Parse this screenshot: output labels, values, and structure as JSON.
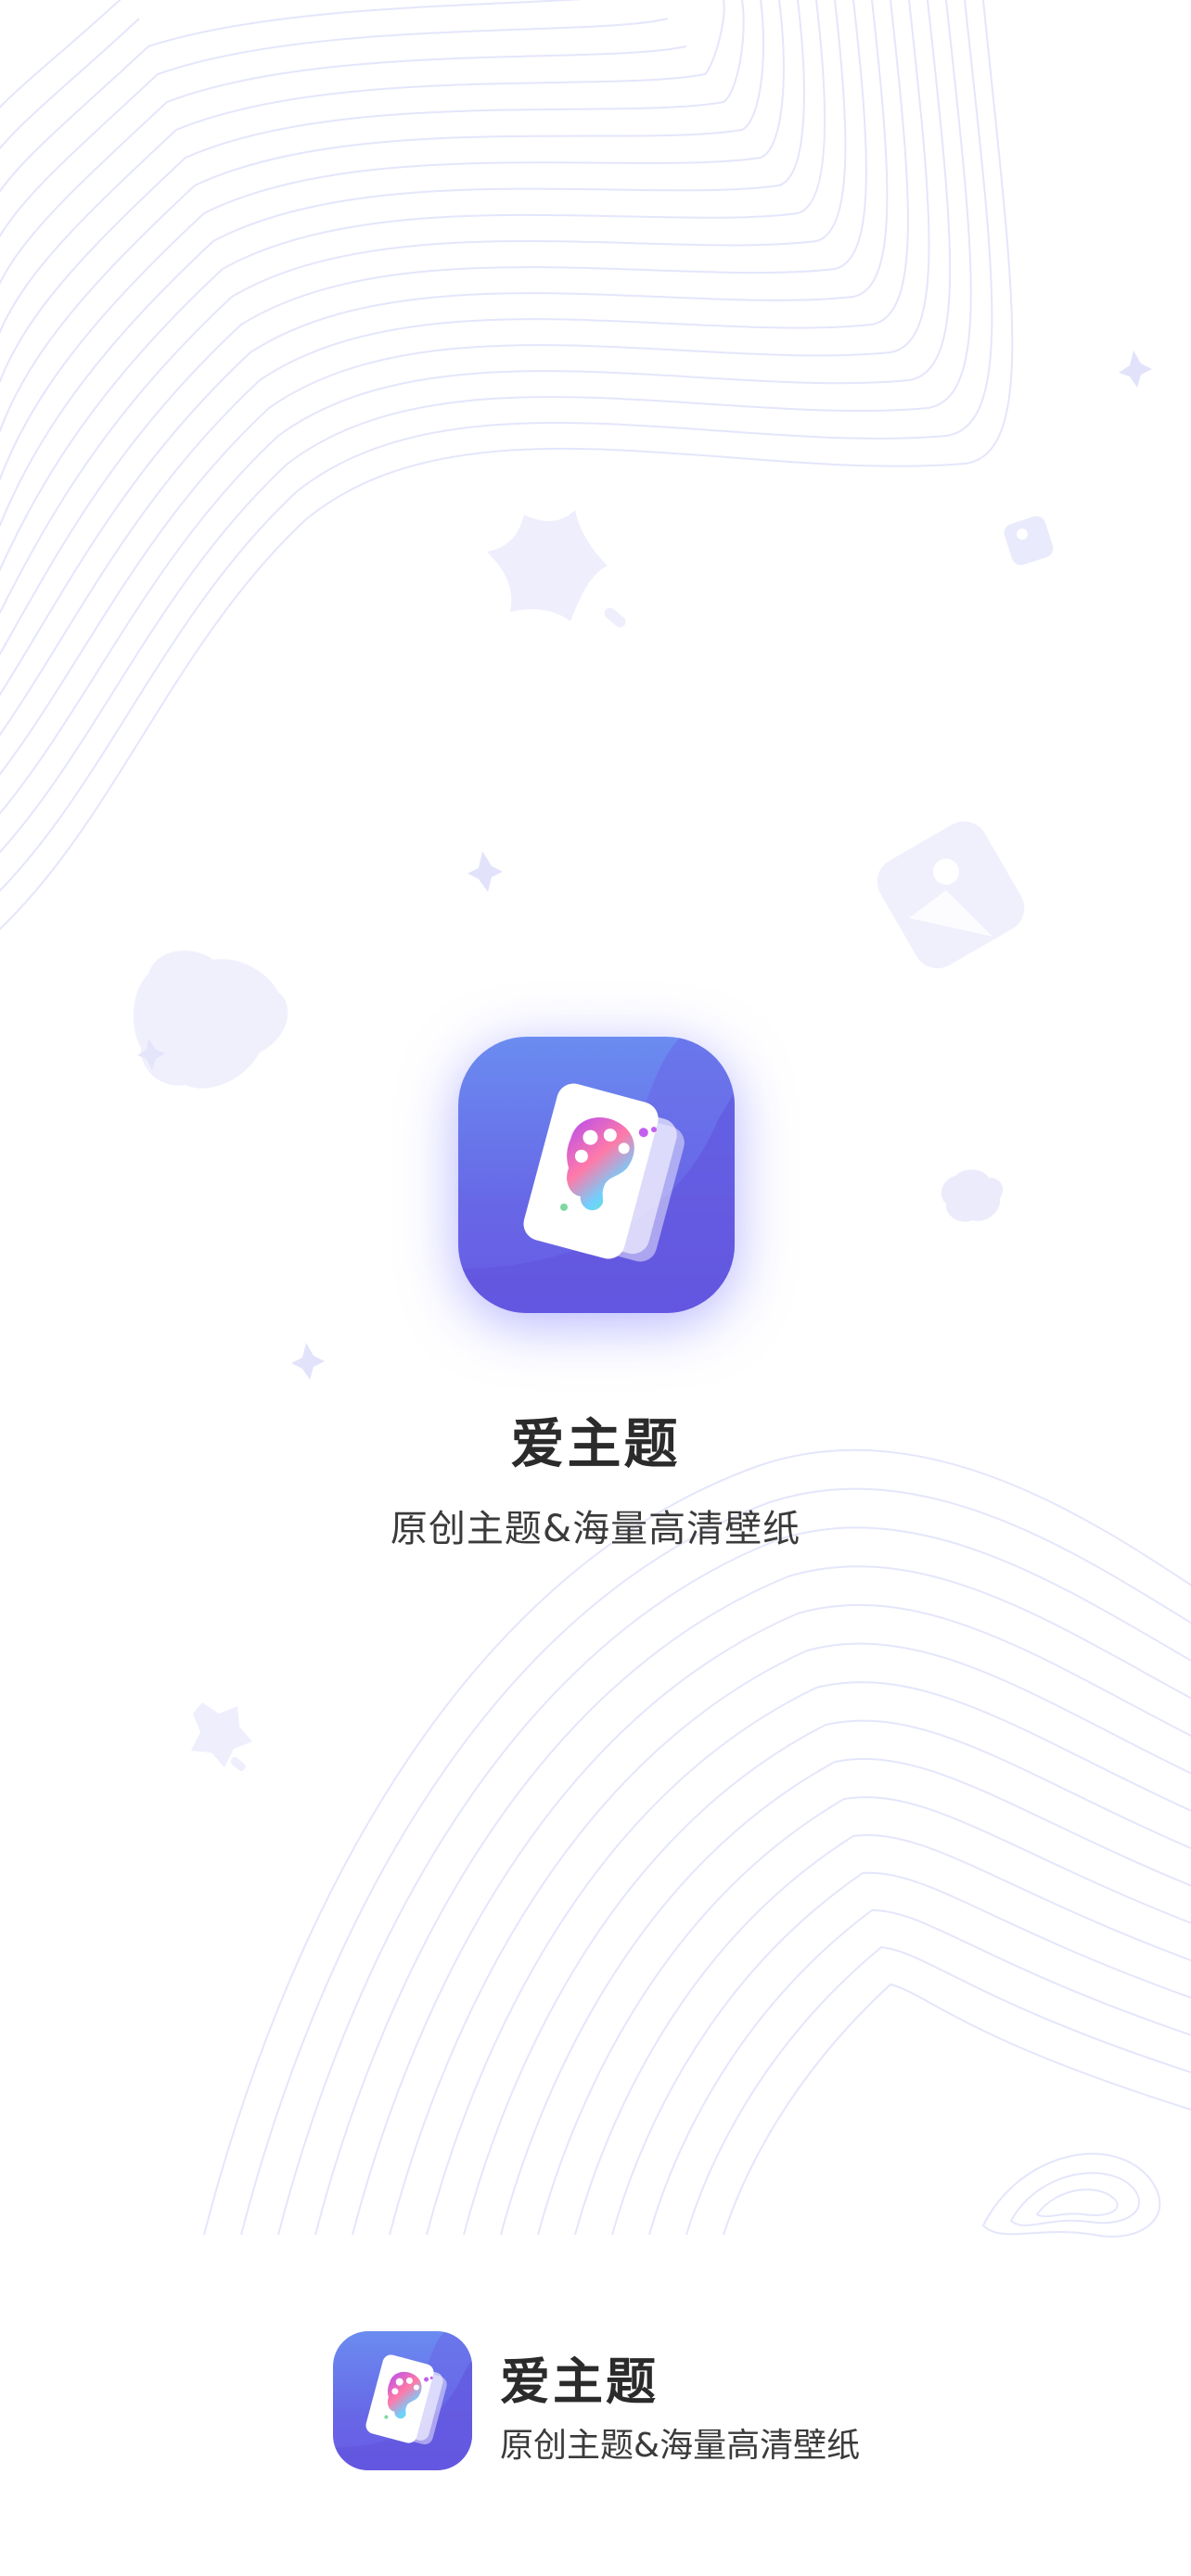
{
  "app": {
    "name": "爱主题",
    "tagline": "原创主题&海量高清壁纸"
  },
  "footer": {
    "name": "爱主题",
    "tagline": "原创主题&海量高清壁纸"
  },
  "colors": {
    "brand_primary": "#6a6ef0",
    "brand_light": "#7e8cf5",
    "decor": "#eeeefd",
    "contour": "#e4e6fb"
  },
  "icons": {
    "app_logo": "palette-card-icon",
    "decorations": [
      "star-icon",
      "image-icon",
      "cloud-icon",
      "sparkle-icon"
    ]
  }
}
